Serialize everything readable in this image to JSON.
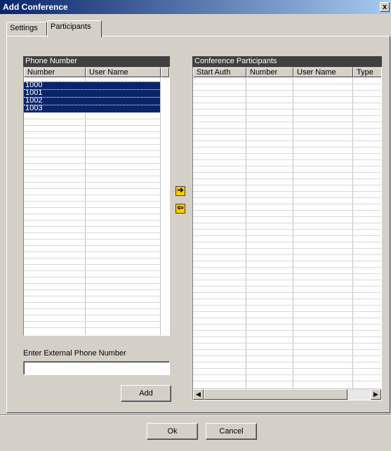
{
  "window": {
    "title": "Add Conference",
    "close_glyph": "x"
  },
  "tabs": [
    {
      "label": "Settings",
      "active": false
    },
    {
      "label": "Participants",
      "active": true
    }
  ],
  "phone_number": {
    "group_title": "Phone Number",
    "columns": [
      "Number",
      "User Name"
    ],
    "rows": [
      {
        "number": "1000",
        "user_name": "",
        "selected": true
      },
      {
        "number": "1001",
        "user_name": "",
        "selected": true
      },
      {
        "number": "1002",
        "user_name": "",
        "selected": true
      },
      {
        "number": "1003",
        "user_name": "",
        "selected": true
      }
    ]
  },
  "move": {
    "add_icon": "arrow-right-icon",
    "remove_icon": "arrow-left-icon",
    "add_glyph": "➔",
    "remove_glyph": "⇦"
  },
  "participants": {
    "group_title": "Conference Participants",
    "columns": [
      "Start Auth",
      "Number",
      "User Name",
      "Type"
    ],
    "rows": []
  },
  "external": {
    "label": "Enter External Phone Number",
    "value": "",
    "placeholder": ""
  },
  "buttons": {
    "add": "Add",
    "ok": "Ok",
    "cancel": "Cancel"
  },
  "scrollbar": {
    "left_glyph": "◀",
    "right_glyph": "▶"
  },
  "colors": {
    "selection": "#0a246a",
    "dialog": "#d4d0c8",
    "group_header": "#404040",
    "arrow_button": "#ffcc00"
  }
}
